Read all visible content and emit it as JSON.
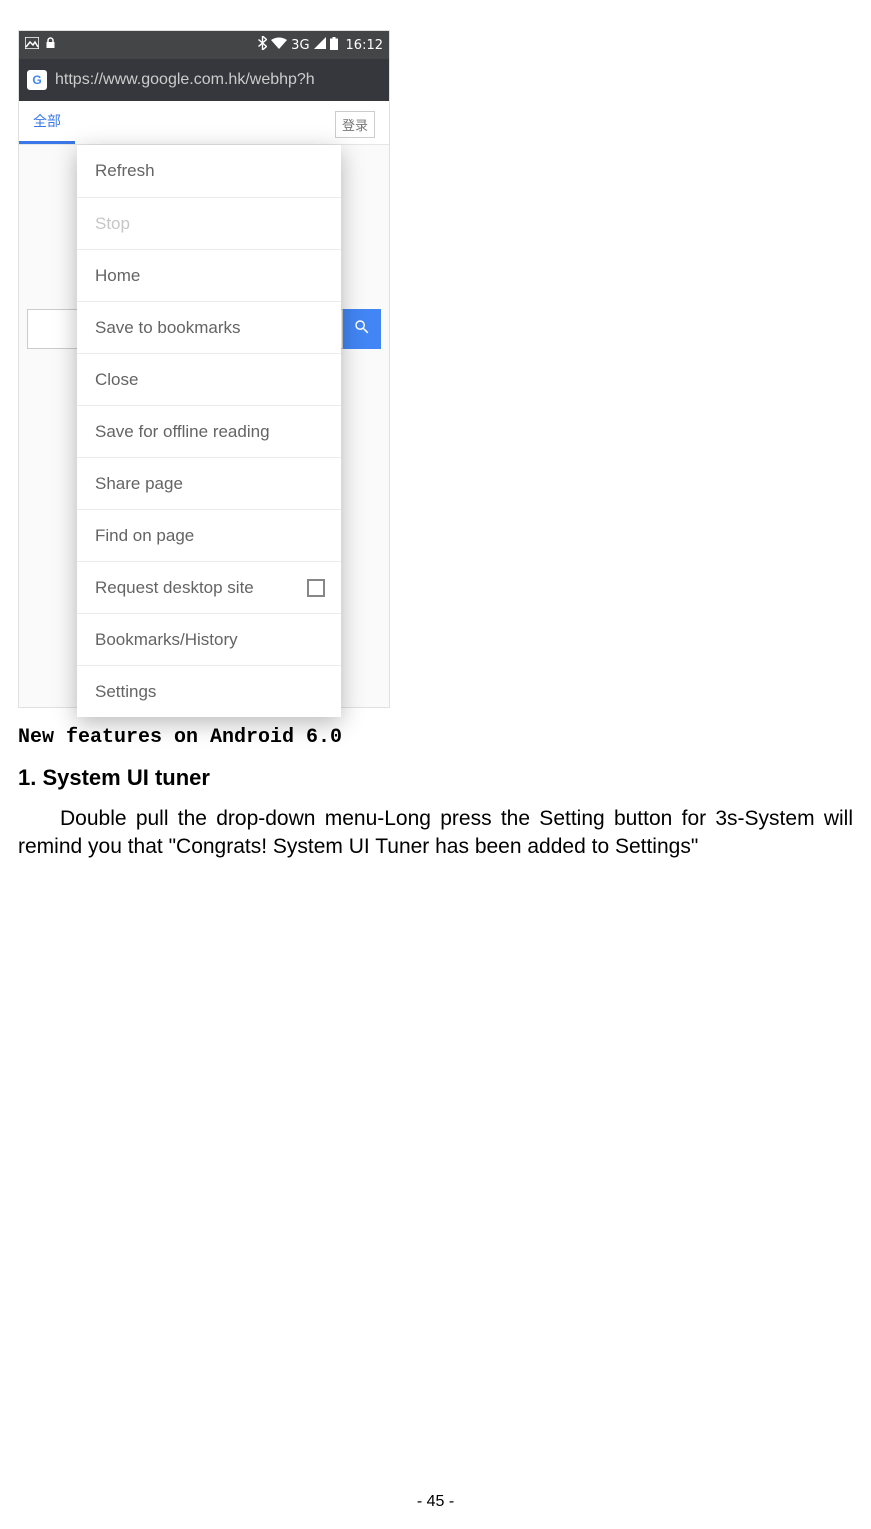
{
  "phone": {
    "status": {
      "time": "16:12",
      "network": "3G"
    },
    "url": "https://www.google.com.hk/webhp?h",
    "tabs": {
      "all_label": "全部",
      "login_label": "登录"
    },
    "menu": {
      "items": [
        {
          "label": "Refresh",
          "disabled": false,
          "has_checkbox": false
        },
        {
          "label": "Stop",
          "disabled": true,
          "has_checkbox": false
        },
        {
          "label": "Home",
          "disabled": false,
          "has_checkbox": false
        },
        {
          "label": "Save to bookmarks",
          "disabled": false,
          "has_checkbox": false
        },
        {
          "label": "Close",
          "disabled": false,
          "has_checkbox": false
        },
        {
          "label": "Save for offline reading",
          "disabled": false,
          "has_checkbox": false
        },
        {
          "label": "Share page",
          "disabled": false,
          "has_checkbox": false
        },
        {
          "label": "Find on page",
          "disabled": false,
          "has_checkbox": false
        },
        {
          "label": "Request desktop site",
          "disabled": false,
          "has_checkbox": true
        },
        {
          "label": "Bookmarks/History",
          "disabled": false,
          "has_checkbox": false
        },
        {
          "label": "Settings",
          "disabled": false,
          "has_checkbox": false
        }
      ]
    }
  },
  "doc": {
    "features_heading": "New features on Android 6.0",
    "section_heading": "1. System UI tuner",
    "body": "Double pull the drop-down menu-Long press the Setting button for 3s-System will remind you that \"Congrats! System UI Tuner has been added to Settings\"",
    "page_number": "- 45 -"
  }
}
